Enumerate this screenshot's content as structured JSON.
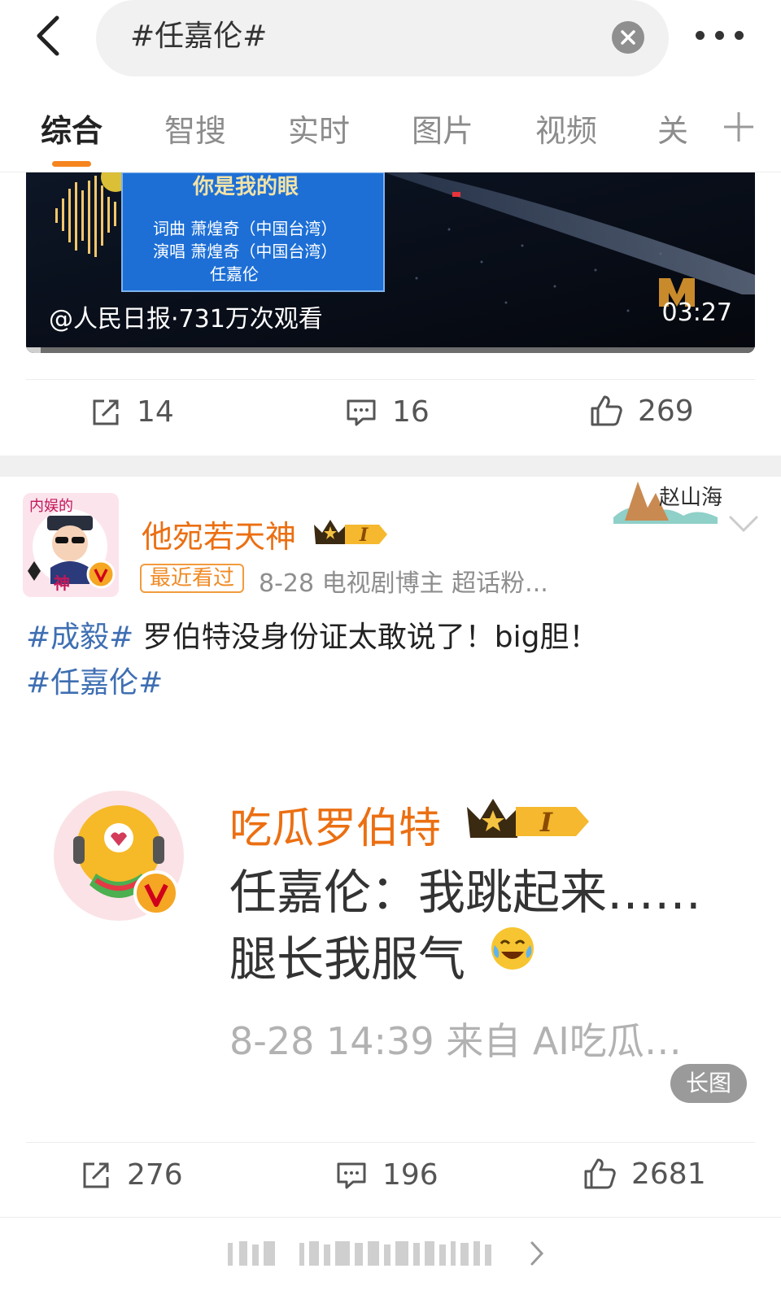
{
  "search": {
    "query": "#任嘉伦#"
  },
  "tabs": [
    {
      "label": "综合",
      "active": true
    },
    {
      "label": "智搜"
    },
    {
      "label": "实时"
    },
    {
      "label": "图片"
    },
    {
      "label": "视频"
    },
    {
      "label": "关"
    }
  ],
  "post1": {
    "video": {
      "caption": "@人民日报·731万次观看",
      "duration": "03:27",
      "title_card": {
        "title": "你是我的眼",
        "line1": "词曲   萧煌奇（中国台湾）",
        "line2": "演唱   萧煌奇（中国台湾）",
        "line3": "任嘉伦"
      },
      "progress": 0.02
    },
    "reposts": "14",
    "comments": "16",
    "likes": "269"
  },
  "post2": {
    "username": "他宛若天神",
    "level": "I",
    "badge": "最近看过",
    "meta": "8-28   电视剧博主 超话粉...",
    "avatar_text_top": "内娱的",
    "avatar_text_bottom": "神",
    "decor_text": "赵山海",
    "topic1": "#成毅#",
    "text": " 罗伯特没身份证太敢说了！big胆！",
    "topic2": "#任嘉伦#",
    "embed": {
      "username": "吃瓜罗伯特",
      "level": "I",
      "line1": "任嘉伦：我跳起来……",
      "line2": "腿长我服气",
      "meta": "8-28 14:39  来自 AI吃瓜…",
      "long_image_label": "长图"
    },
    "reposts": "276",
    "comments": "196",
    "likes": "2681"
  },
  "colors": {
    "accent": "#f6851f",
    "username": "#eb6f12",
    "topic": "#3f6fb3",
    "verified": "#f5a623"
  }
}
